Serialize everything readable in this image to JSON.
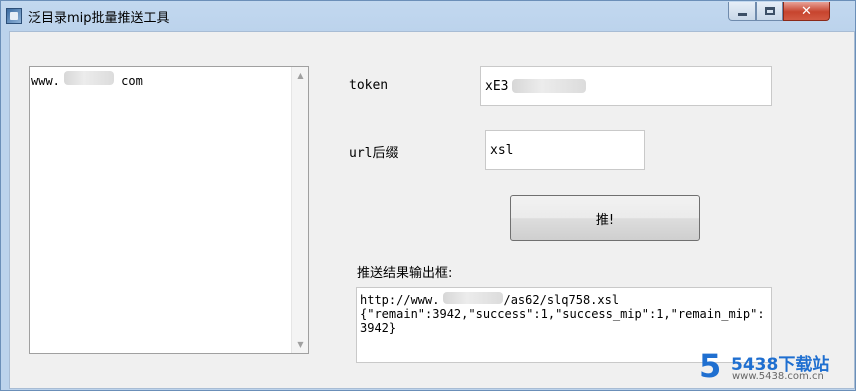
{
  "window": {
    "title": "泛目录mip批量推送工具",
    "minimize_glyph": "",
    "maximize_glyph": "",
    "close_glyph": "✕"
  },
  "domain_list": {
    "item_prefix": "www.",
    "item_suffix": "com"
  },
  "token": {
    "label": "token",
    "value_prefix": "xE3"
  },
  "url_suffix": {
    "label": "url后缀",
    "value": "xsl"
  },
  "push_button": {
    "label": "推!"
  },
  "output": {
    "label": "推送结果输出框:",
    "line1_prefix": "http://www.",
    "line1_suffix": "/as62/slq758.xsl",
    "line2": "{\"remain\":3942,\"success\":1,\"success_mip\":1,\"remain_mip\":3942}"
  },
  "watermark": {
    "logo": "5",
    "text": "5438下载站",
    "url": "www.5438.com.cn"
  },
  "icons": {
    "app": "app-icon",
    "scroll_up": "chevron-up-icon",
    "scroll_down": "chevron-down-icon"
  }
}
